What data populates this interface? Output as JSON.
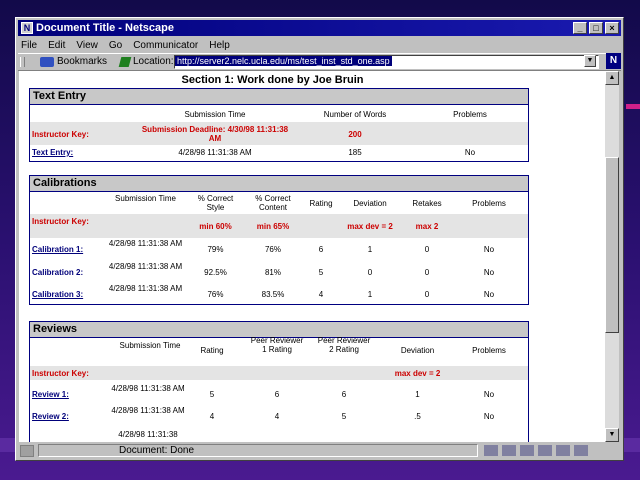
{
  "window": {
    "title": "Document Title - Netscape",
    "menu": [
      "File",
      "Edit",
      "View",
      "Go",
      "Communicator",
      "Help"
    ],
    "bookmarks_label": "Bookmarks",
    "location_label": "Location:",
    "url": "http://server2.nelc.ucla.edu/ms/test_inst_std_one.asp",
    "status": "Document: Done"
  },
  "page": {
    "heading": "Section 1: Work done by Joe Bruin",
    "text_entry": {
      "title": "Text Entry",
      "headers": {
        "submission_time": "Submission Time",
        "words": "Number of Words",
        "problems": "Problems"
      },
      "instructor_label": "Instructor Key:",
      "instructor_deadline": "Submission Deadline: 4/30/98 11:31:38 AM",
      "instructor_words": "200",
      "row_label": "Text Entry:",
      "row_time": "4/28/98 11:31:38 AM",
      "row_words": "185",
      "row_problems": "No"
    },
    "calibrations": {
      "title": "Calibrations",
      "headers": {
        "submission_time": "Submission Time",
        "pct_style": "% Correct Style",
        "pct_content": "% Correct Content",
        "rating": "Rating",
        "deviation": "Deviation",
        "retakes": "Retakes",
        "problems": "Problems"
      },
      "instructor_label": "Instructor Key:",
      "instructor_style": "min 60%",
      "instructor_content": "min 65%",
      "instructor_deviation": "max dev = 2",
      "instructor_retakes": "max 2",
      "rows": [
        {
          "label": "Calibration 1:",
          "time": "4/28/98 11:31:38 AM",
          "style": "79%",
          "content": "76%",
          "rating": "6",
          "deviation": "1",
          "retakes": "0",
          "problems": "No"
        },
        {
          "label": "Calibration 2:",
          "time": "4/28/98 11:31:38 AM",
          "style": "92.5%",
          "content": "81%",
          "rating": "5",
          "deviation": "0",
          "retakes": "0",
          "problems": "No"
        },
        {
          "label": "Calibration 3:",
          "time": "4/28/98 11:31:38 AM",
          "style": "76%",
          "content": "83.5%",
          "rating": "4",
          "deviation": "1",
          "retakes": "0",
          "problems": "No"
        }
      ]
    },
    "reviews": {
      "title": "Reviews",
      "headers": {
        "submission_time": "Submission Time",
        "rating": "Rating",
        "peer1": "Peer Reviewer 1 Rating",
        "peer2": "Peer Reviewer 2 Rating",
        "deviation": "Deviation",
        "problems": "Problems"
      },
      "instructor_label": "Instructor Key:",
      "instructor_deviation": "max dev = 2",
      "rows": [
        {
          "label": "Review 1:",
          "time": "4/28/98 11:31:38 AM",
          "rating": "5",
          "peer1": "6",
          "peer2": "6",
          "deviation": "1",
          "problems": "No"
        },
        {
          "label": "Review 2:",
          "time": "4/28/98 11:31:38 AM",
          "rating": "4",
          "peer1": "4",
          "peer2": "5",
          "deviation": ".5",
          "problems": "No"
        },
        {
          "label": "",
          "time": "4/28/98 11:31:38",
          "rating": "",
          "peer1": "",
          "peer2": "",
          "deviation": "",
          "problems": ""
        }
      ]
    }
  }
}
